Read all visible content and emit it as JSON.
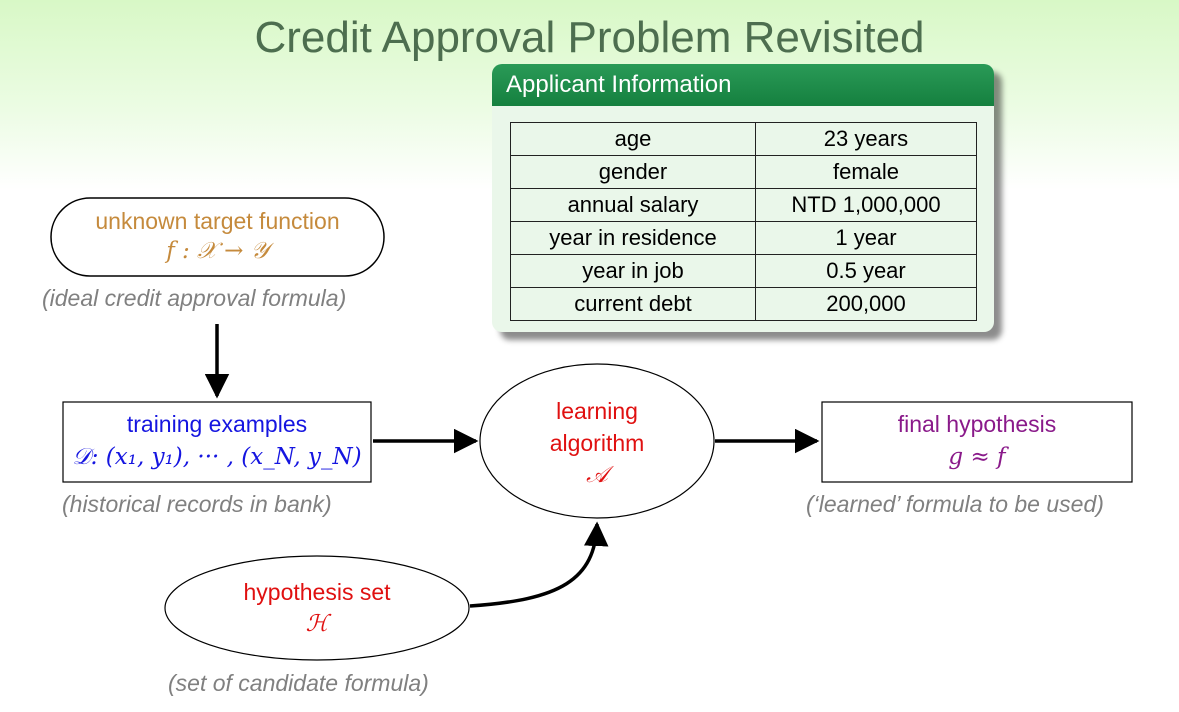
{
  "title": "Credit Approval Problem Revisited",
  "applicant_card": {
    "header": "Applicant Information",
    "rows": [
      {
        "key": "age",
        "value": "23 years"
      },
      {
        "key": "gender",
        "value": "female"
      },
      {
        "key": "annual salary",
        "value": "NTD 1,000,000"
      },
      {
        "key": "year in residence",
        "value": "1 year"
      },
      {
        "key": "year in job",
        "value": "0.5 year"
      },
      {
        "key": "current debt",
        "value": "200,000"
      }
    ]
  },
  "target": {
    "label": "unknown target function",
    "formula": "f : 𝒳 → 𝒴",
    "note": "(ideal credit approval formula)"
  },
  "training": {
    "label": "training examples",
    "formula": "𝒟: (x₁, y₁), ··· , (x_N, y_N)",
    "note": "(historical records in bank)"
  },
  "algorithm": {
    "label_line1": "learning",
    "label_line2": "algorithm",
    "symbol": "𝒜"
  },
  "hypothesis_final": {
    "label": "final hypothesis",
    "formula": "g ≈ f",
    "note": "(‘learned’ formula to be used)"
  },
  "hypothesis_set": {
    "label": "hypothesis set",
    "symbol": "ℋ",
    "note": "(set of candidate formula)"
  },
  "colors": {
    "title": "#4d6e4f",
    "card_header": "#1a8a48",
    "blue": "#1515e0",
    "red": "#e01010",
    "orange": "#c58a3c",
    "purple": "#8a1a8a",
    "note": "#808080"
  }
}
